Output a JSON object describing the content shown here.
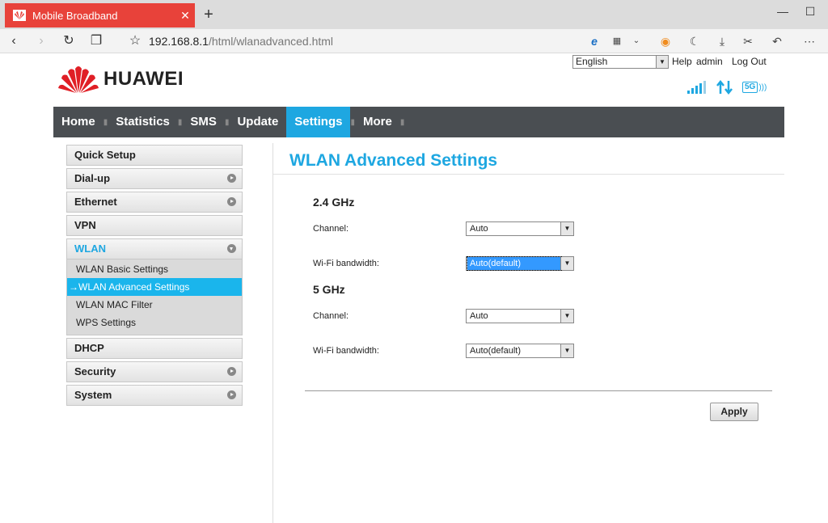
{
  "browser": {
    "tab_title": "Mobile Broadband",
    "url_host": "192.168.8.1",
    "url_path": "/html/wlanadvanced.html"
  },
  "header": {
    "language": "English",
    "help": "Help",
    "user": "admin",
    "logout": "Log Out",
    "brand": "HUAWEI",
    "network_badge": "5G"
  },
  "nav": {
    "items": [
      "Home",
      "Statistics",
      "SMS",
      "Update",
      "Settings",
      "More"
    ],
    "active": "Settings"
  },
  "sidebar": {
    "quick_setup": "Quick Setup",
    "dialup": "Dial-up",
    "ethernet": "Ethernet",
    "vpn": "VPN",
    "wlan": "WLAN",
    "wlan_sub": [
      "WLAN Basic Settings",
      "→WLAN Advanced Settings",
      "WLAN MAC Filter",
      "WPS Settings"
    ],
    "dhcp": "DHCP",
    "security": "Security",
    "system": "System"
  },
  "main": {
    "title": "WLAN Advanced Settings",
    "band24": {
      "heading": "2.4 GHz",
      "channel_label": "Channel:",
      "channel_value": "Auto",
      "bandwidth_label": "Wi-Fi bandwidth:",
      "bandwidth_value": "Auto(default)"
    },
    "band5": {
      "heading": "5 GHz",
      "channel_label": "Channel:",
      "channel_value": "Auto",
      "bandwidth_label": "Wi-Fi bandwidth:",
      "bandwidth_value": "Auto(default)"
    },
    "apply": "Apply"
  },
  "colors": {
    "accent": "#1ea7e1",
    "nav_bg": "#4a4e52",
    "tab_red": "#e8423a"
  }
}
